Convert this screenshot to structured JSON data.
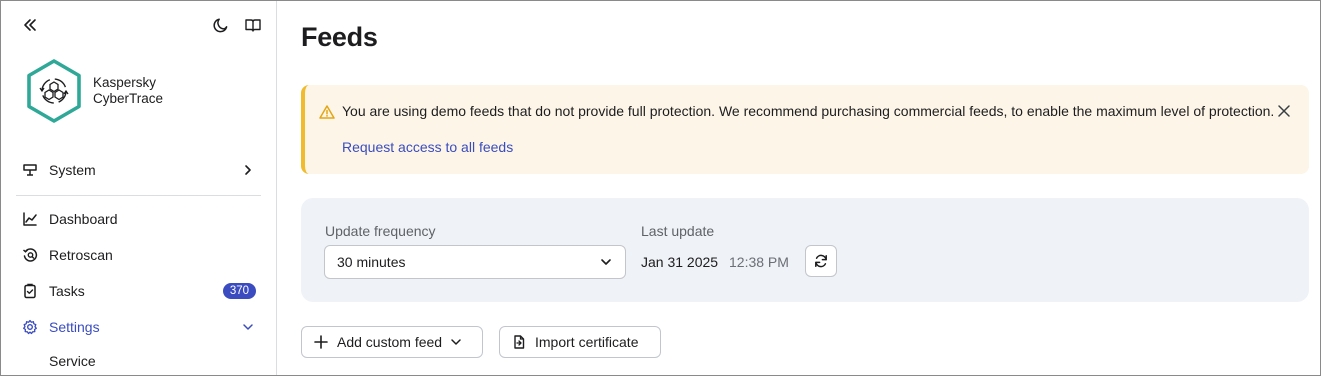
{
  "sidebar": {
    "brand": {
      "line1": "Kaspersky",
      "line2": "CyberTrace"
    },
    "items": [
      {
        "label": "System",
        "icon": "system-icon"
      },
      {
        "label": "Dashboard",
        "icon": "chart-line-icon"
      },
      {
        "label": "Retroscan",
        "icon": "retroscan-icon"
      },
      {
        "label": "Tasks",
        "icon": "clipboard-check-icon",
        "badge": "370"
      },
      {
        "label": "Settings",
        "icon": "gear-icon"
      }
    ],
    "sub_item": "Service"
  },
  "page": {
    "title": "Feeds"
  },
  "alert": {
    "message": "You are using demo feeds that do not provide full protection. We recommend purchasing commercial feeds, to enable the maximum level of protection.",
    "link": "Request access to all feeds"
  },
  "update": {
    "frequency_label": "Update frequency",
    "frequency_value": "30 minutes",
    "last_update_label": "Last update",
    "last_update_date": "Jan 31 2025",
    "last_update_time": "12:38 PM"
  },
  "actions": {
    "add_custom_feed": "Add custom feed",
    "import_certificate": "Import certificate"
  },
  "colors": {
    "accent": "#3a4cbf",
    "logo": "#2fa898",
    "alert_bg": "#fdf6e8",
    "alert_border": "#f0bb2e",
    "panel_bg": "#eff2f6"
  }
}
